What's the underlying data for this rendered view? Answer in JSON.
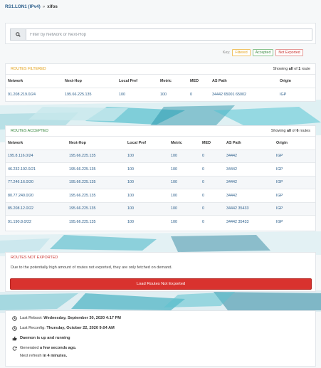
{
  "breadcrumb": {
    "router": "RS1.LON1 (IPv4)",
    "separator": "»",
    "current": "xifos"
  },
  "search": {
    "placeholder": "Filter by Network or Next-Hop",
    "icon": "search-icon"
  },
  "legend": {
    "label": "Key:",
    "filtered": "Filtered",
    "accepted": "Accepted",
    "not_exported": "Not Exported"
  },
  "colors": {
    "filtered": "#e3a21a",
    "accepted": "#37873d",
    "not_exported": "#c9302c",
    "link": "#2a5d8a",
    "button": "#d9322e"
  },
  "filtered": {
    "title": "ROUTES FILTERED",
    "showing_pre": "Showing ",
    "showing_mid": "all",
    "showing_of": " of ",
    "showing_count": "1",
    "showing_post": " route",
    "columns": [
      "Network",
      "Next-Hop",
      "Local Pref",
      "Metric",
      "MED",
      "AS Path",
      "Origin"
    ],
    "rows": [
      [
        "91.208.219.0/24",
        "195.66.225.135",
        "100",
        "100",
        "0",
        "34442 65001 65002",
        "IGP"
      ]
    ]
  },
  "accepted": {
    "title": "ROUTES ACCEPTED",
    "showing_pre": "Showing ",
    "showing_mid": "all",
    "showing_of": " of ",
    "showing_count": "6",
    "showing_post": " routes",
    "columns": [
      "Network",
      "Next-Hop",
      "Local Pref",
      "Metric",
      "MED",
      "AS Path",
      "Origin"
    ],
    "rows": [
      [
        "195.8.116.0/24",
        "195.66.225.135",
        "100",
        "100",
        "0",
        "34442",
        "IGP"
      ],
      [
        "46.232.192.0/21",
        "195.66.225.135",
        "100",
        "100",
        "0",
        "34442",
        "IGP"
      ],
      [
        "77.246.16.0/20",
        "195.66.225.135",
        "100",
        "100",
        "0",
        "34442",
        "IGP"
      ],
      [
        "80.77.240.0/20",
        "195.66.225.135",
        "100",
        "100",
        "0",
        "34442",
        "IGP"
      ],
      [
        "85.208.12.0/22",
        "195.66.225.135",
        "100",
        "100",
        "0",
        "34442 35433",
        "IGP"
      ],
      [
        "91.190.8.0/22",
        "195.66.225.135",
        "100",
        "100",
        "0",
        "34442 35433",
        "IGP"
      ]
    ]
  },
  "not_exported": {
    "title": "ROUTES NOT EXPORTED",
    "message": "Due to the potentially high amount of routes not exported, they are only fetched on demand.",
    "button_label": "Load Routes Not Exported"
  },
  "status": {
    "reboot_label": "Last Reboot: ",
    "reboot_value": "Wednesday, September 30, 2020 4:17 PM",
    "reconfig_label": "Last Reconfig: ",
    "reconfig_value": "Thursday, October 22, 2020 9:04 AM",
    "daemon": "Daemon is up and running",
    "generated_pre": "Generated ",
    "generated_value": "a few seconds ago.",
    "next_pre": "Next refresh ",
    "next_value": "in 4 minutes."
  }
}
